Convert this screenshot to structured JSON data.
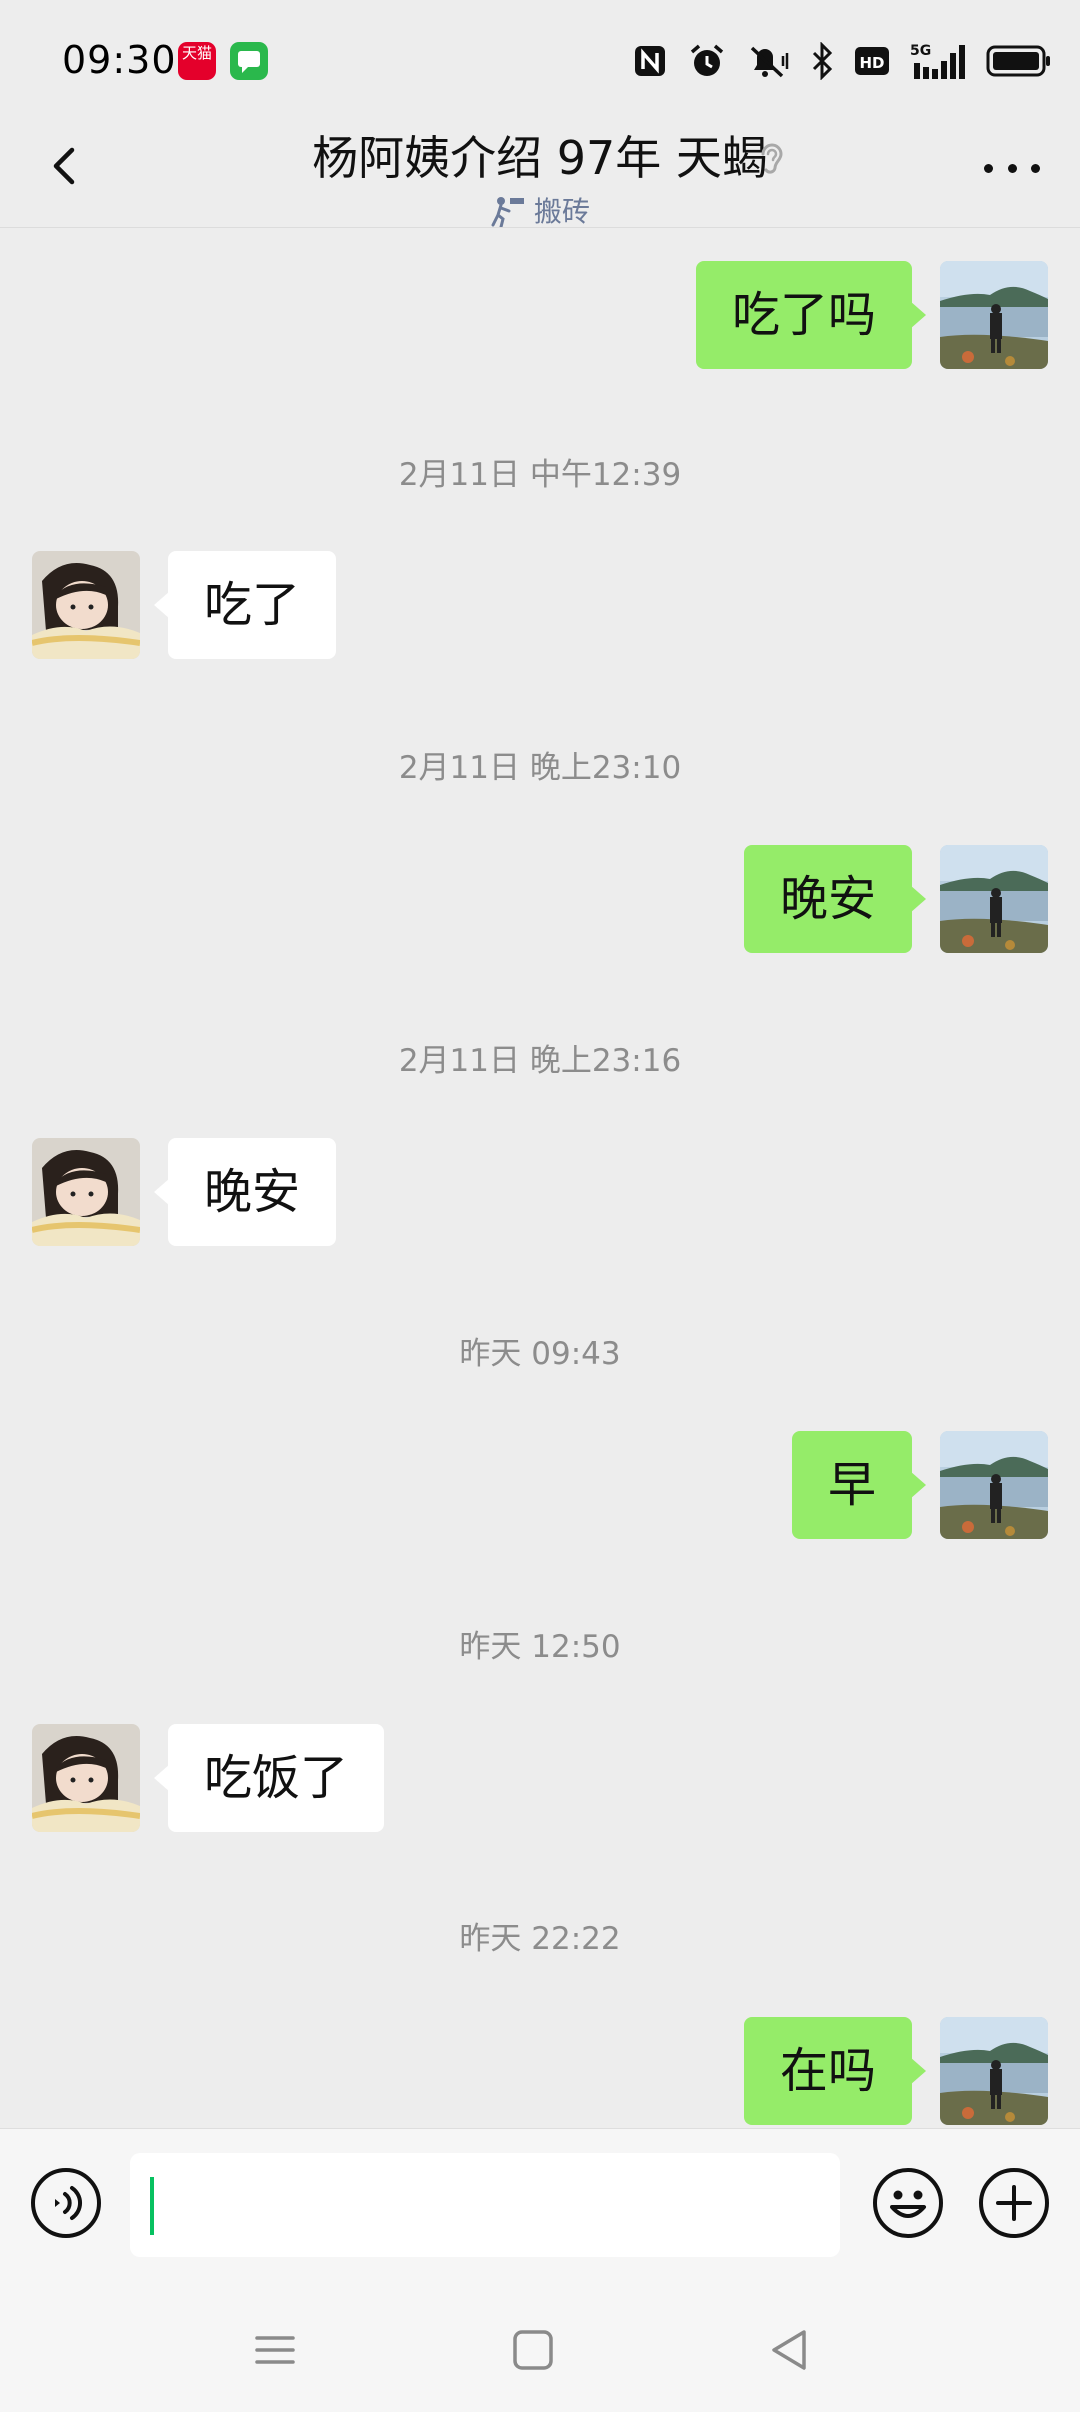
{
  "status_bar": {
    "time": "09:30",
    "tmall_label": "天猫",
    "network": "5G"
  },
  "header": {
    "title": "杨阿姨介绍 97年 天蝎",
    "subtitle": "搬砖"
  },
  "messages": [
    {
      "type": "message",
      "side": "right",
      "text": "吃了吗"
    },
    {
      "type": "time",
      "text": "2月11日 中午12:39"
    },
    {
      "type": "message",
      "side": "left",
      "text": "吃了"
    },
    {
      "type": "time",
      "text": "2月11日 晚上23:10"
    },
    {
      "type": "message",
      "side": "right",
      "text": "晚安"
    },
    {
      "type": "time",
      "text": "2月11日 晚上23:16"
    },
    {
      "type": "message",
      "side": "left",
      "text": "晚安"
    },
    {
      "type": "time",
      "text": "昨天 09:43"
    },
    {
      "type": "message",
      "side": "right",
      "text": "早"
    },
    {
      "type": "time",
      "text": "昨天 12:50"
    },
    {
      "type": "message",
      "side": "left",
      "text": "吃饭了"
    },
    {
      "type": "time",
      "text": "昨天 22:22"
    },
    {
      "type": "message",
      "side": "right",
      "text": "在吗"
    }
  ],
  "input": {
    "value": "",
    "placeholder": ""
  },
  "colors": {
    "background": "#ededed",
    "sent_bubble": "#95ec69",
    "received_bubble": "#ffffff",
    "timestamp": "#8c8c8c",
    "caret": "#07c160"
  },
  "icons": {
    "back": "back-arrow-icon",
    "listen": "ear-icon",
    "more": "more-dots-icon",
    "voice": "voice-icon",
    "emoji": "emoji-icon",
    "plus": "plus-icon"
  }
}
